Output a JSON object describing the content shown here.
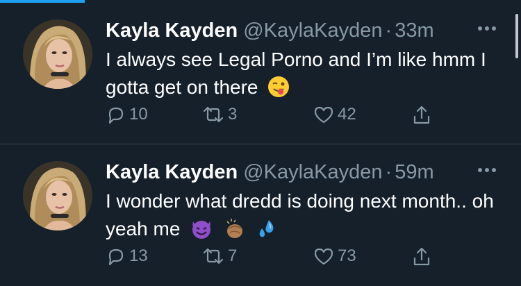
{
  "tweets": [
    {
      "name": "Kayla Kayden",
      "handle": "@KaylaKayden",
      "dot": "·",
      "time": "33m",
      "text": "I always see Legal Porno and I’m like hmm I gotta get on there",
      "emojis": [
        "winking-face-with-tongue"
      ],
      "replies": "10",
      "retweets": "3",
      "likes": "42"
    },
    {
      "name": "Kayla Kayden",
      "handle": "@KaylaKayden",
      "dot": "·",
      "time": "59m",
      "text": "I wonder what dredd is doing next month.. oh yeah me",
      "emojis": [
        "smiling-face-with-horns",
        "clapping-hands",
        "sweat-droplets"
      ],
      "replies": "13",
      "retweets": "7",
      "likes": "73"
    }
  ],
  "colors": {
    "background": "#15202b",
    "secondary_text": "#8899a6",
    "divider": "#38444d",
    "accent": "#1da1f2"
  }
}
